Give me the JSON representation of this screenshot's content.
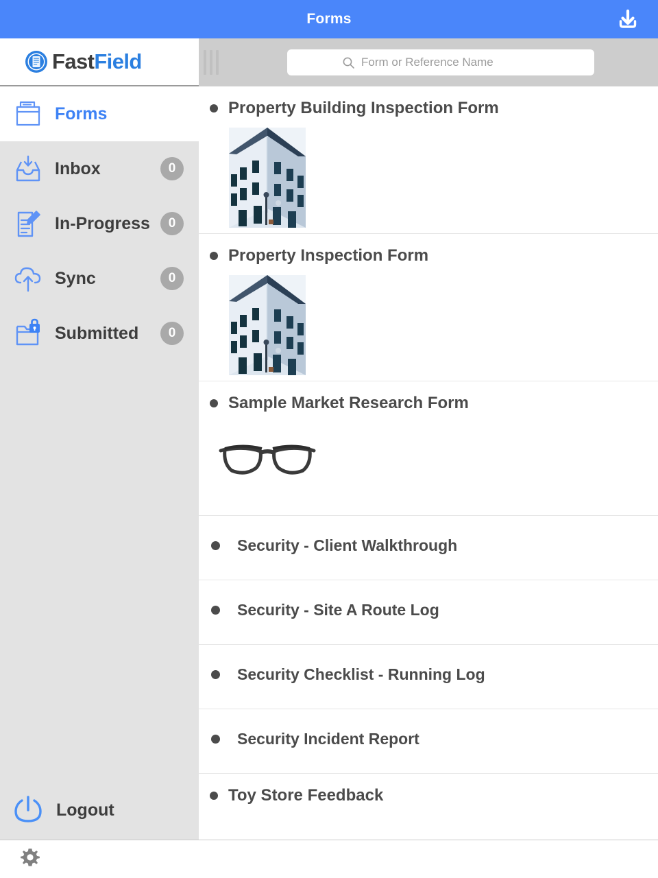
{
  "titlebar": {
    "title": "Forms",
    "download_icon": "download-icon",
    "background": "#4a86fa"
  },
  "brand": {
    "name_primary": "Fast",
    "name_secondary": "Field",
    "logo_icon": "fastfield-document-logo-icon",
    "color_primary": "#3c3c3c",
    "color_secondary": "#2b7fe0"
  },
  "sidebar": {
    "background": "#e3e3e3",
    "active_color": "#3d82f5",
    "items": [
      {
        "label": "Forms",
        "icon": "folder-forms-icon",
        "badge": null,
        "active": true
      },
      {
        "label": "Inbox",
        "icon": "inbox-tray-icon",
        "badge": "0",
        "active": false
      },
      {
        "label": "In-Progress",
        "icon": "document-pencil-icon",
        "badge": "0",
        "active": false
      },
      {
        "label": "Sync",
        "icon": "cloud-upload-icon",
        "badge": "0",
        "active": false
      },
      {
        "label": "Submitted",
        "icon": "folder-lock-icon",
        "badge": "0",
        "active": false
      }
    ],
    "logout": {
      "label": "Logout",
      "icon": "power-icon"
    }
  },
  "toolbar": {
    "grip_icon": "drag-grip-icon",
    "search": {
      "placeholder": "Form or Reference Name",
      "value": "",
      "icon": "search-icon"
    }
  },
  "form_list": [
    {
      "title": "Property Building Inspection Form",
      "thumbnail": "building-corner-photo",
      "has_image": true
    },
    {
      "title": "Property Inspection Form",
      "thumbnail": "building-corner-photo",
      "has_image": true
    },
    {
      "title": "Sample Market Research Form",
      "thumbnail": "eyeglasses-photo",
      "has_image": true
    },
    {
      "title": "Security - Client Walkthrough",
      "thumbnail": null,
      "has_image": false
    },
    {
      "title": "Security - Site A Route Log",
      "thumbnail": null,
      "has_image": false
    },
    {
      "title": "Security Checklist - Running Log",
      "thumbnail": null,
      "has_image": false
    },
    {
      "title": "Security Incident Report",
      "thumbnail": null,
      "has_image": false
    },
    {
      "title": "Toy Store Feedback",
      "thumbnail": null,
      "has_image": true
    }
  ],
  "bottombar": {
    "settings_icon": "gear-icon"
  }
}
